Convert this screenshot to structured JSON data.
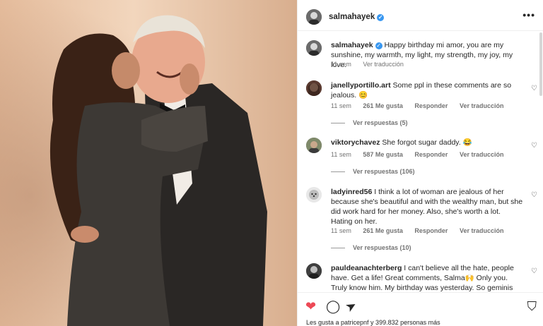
{
  "post": {
    "username": "salmahayek",
    "caption": "Happy birthday mi amor, you are my sunshine, my warmth, my light, my strength, my joy, my love.",
    "time": "11 sem",
    "see_translation": "Ver traducción"
  },
  "comments": [
    {
      "username": "janellyportillo.art",
      "text": "Some ppl in these comments are so jealous. 😊",
      "time": "11 sem",
      "likes": "261 Me gusta",
      "reply": "Responder",
      "translate": "Ver traducción",
      "replies": "Ver respuestas (5)"
    },
    {
      "username": "viktorychavez",
      "text": "She forgot sugar daddy. 😂",
      "time": "11 sem",
      "likes": "587 Me gusta",
      "reply": "Responder",
      "translate": "Ver traducción",
      "replies": "Ver respuestas (106)"
    },
    {
      "username": "ladyinred56",
      "text": "I think a lot of woman are jealous of her because she's beautiful and with the wealthy man, but she did work hard for her money. Also, she's worth a lot. Hating on her.",
      "time": "11 sem",
      "likes": "261 Me gusta",
      "reply": "Responder",
      "translate": "Ver traducción",
      "replies": "Ver respuestas (10)"
    },
    {
      "username": "pauldeanachterberg",
      "text": "I can't believe all the hate, people have. Get a life! Great comments, Salma🙌 Only you. Truly know him. My birthday was yesterday. So geminis are good"
    }
  ],
  "likes_text": "Les gusta a patricepnf y 399.832 personas más",
  "icons": {
    "more": "•••",
    "heart_small": "♡",
    "like": "❤",
    "comment": "◯",
    "share": "➤",
    "save": "⛉"
  },
  "colors": {
    "verified": "#3897f0",
    "like_red": "#ed4956"
  }
}
